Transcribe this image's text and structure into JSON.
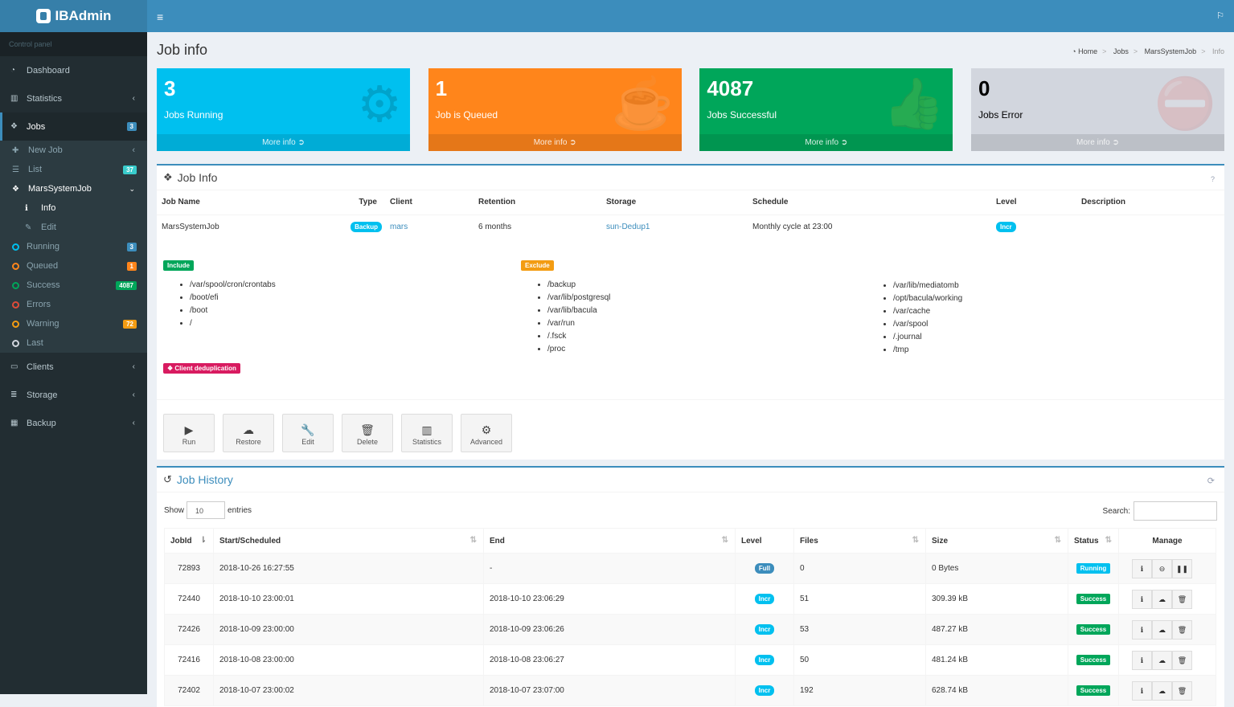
{
  "app": {
    "title": "IBAdmin",
    "control_panel": "Control panel"
  },
  "sidebar": {
    "dashboard": "Dashboard",
    "statistics": "Statistics",
    "jobs": "Jobs",
    "jobs_badge": "3",
    "new_job": "New Job",
    "list": "List",
    "list_badge": "37",
    "marsjob": "MarsSystemJob",
    "info": "Info",
    "edit": "Edit",
    "running": "Running",
    "running_badge": "3",
    "queued": "Queued",
    "queued_badge": "1",
    "success": "Success",
    "success_badge": "4087",
    "errors": "Errors",
    "warning": "Warning",
    "warning_badge": "72",
    "last": "Last",
    "clients": "Clients",
    "storage": "Storage",
    "backup": "Backup"
  },
  "page": {
    "title": "Job info",
    "breadcrumb": [
      "Home",
      "Jobs",
      "MarsSystemJob",
      "Info"
    ]
  },
  "stats": [
    {
      "num": "3",
      "label": "Jobs Running",
      "more": "More info",
      "color": "#00c0ef"
    },
    {
      "num": "1",
      "label": "Job is Queued",
      "more": "More info",
      "color": "#ff851b"
    },
    {
      "num": "4087",
      "label": "Jobs Successful",
      "more": "More info",
      "color": "#00a65a"
    },
    {
      "num": "0",
      "label": "Jobs Error",
      "more": "More info",
      "color": "#d2d6de"
    }
  ],
  "jobinfo": {
    "title": "Job Info",
    "help": "?",
    "headers": [
      "Job Name",
      "Type",
      "Client",
      "Retention",
      "Storage",
      "Schedule",
      "Level",
      "Description"
    ],
    "row": {
      "name": "MarsSystemJob",
      "type": "Backup",
      "client": "mars",
      "retention": "6 months",
      "storage": "sun-Dedup1",
      "schedule": "Monthly cycle at 23:00",
      "level": "Incr"
    },
    "include_label": "Include",
    "exclude_label": "Exclude",
    "include": [
      "/var/spool/cron/crontabs",
      "/boot/efi",
      "/boot",
      "/"
    ],
    "exclude1": [
      "/backup",
      "/var/lib/postgresql",
      "/var/lib/bacula",
      "/var/run",
      "/.fsck",
      "/proc"
    ],
    "exclude2": [
      "/var/lib/mediatomb",
      "/opt/bacula/working",
      "/var/cache",
      "/var/spool",
      "/.journal",
      "/tmp"
    ],
    "dedup": "Client deduplication",
    "actions": [
      "Run",
      "Restore",
      "Edit",
      "Delete",
      "Statistics",
      "Advanced"
    ]
  },
  "history": {
    "title": "Job History",
    "show": "Show",
    "entries": "entries",
    "page_size": "10",
    "search": "Search:",
    "headers": [
      "JobId",
      "Start/Scheduled",
      "End",
      "Level",
      "Files",
      "Size",
      "Status",
      "Manage"
    ],
    "rows": [
      {
        "id": "72893",
        "start": "2018-10-26 16:27:55",
        "end": "-",
        "level": "Full",
        "files": "0",
        "size": "0 Bytes",
        "status": "Running"
      },
      {
        "id": "72440",
        "start": "2018-10-10 23:00:01",
        "end": "2018-10-10 23:06:29",
        "level": "Incr",
        "files": "51",
        "size": "309.39 kB",
        "status": "Success"
      },
      {
        "id": "72426",
        "start": "2018-10-09 23:00:00",
        "end": "2018-10-09 23:06:26",
        "level": "Incr",
        "files": "53",
        "size": "487.27 kB",
        "status": "Success"
      },
      {
        "id": "72416",
        "start": "2018-10-08 23:00:00",
        "end": "2018-10-08 23:06:27",
        "level": "Incr",
        "files": "50",
        "size": "481.24 kB",
        "status": "Success"
      },
      {
        "id": "72402",
        "start": "2018-10-07 23:00:02",
        "end": "2018-10-07 23:07:00",
        "level": "Incr",
        "files": "192",
        "size": "628.74 kB",
        "status": "Success"
      }
    ]
  }
}
